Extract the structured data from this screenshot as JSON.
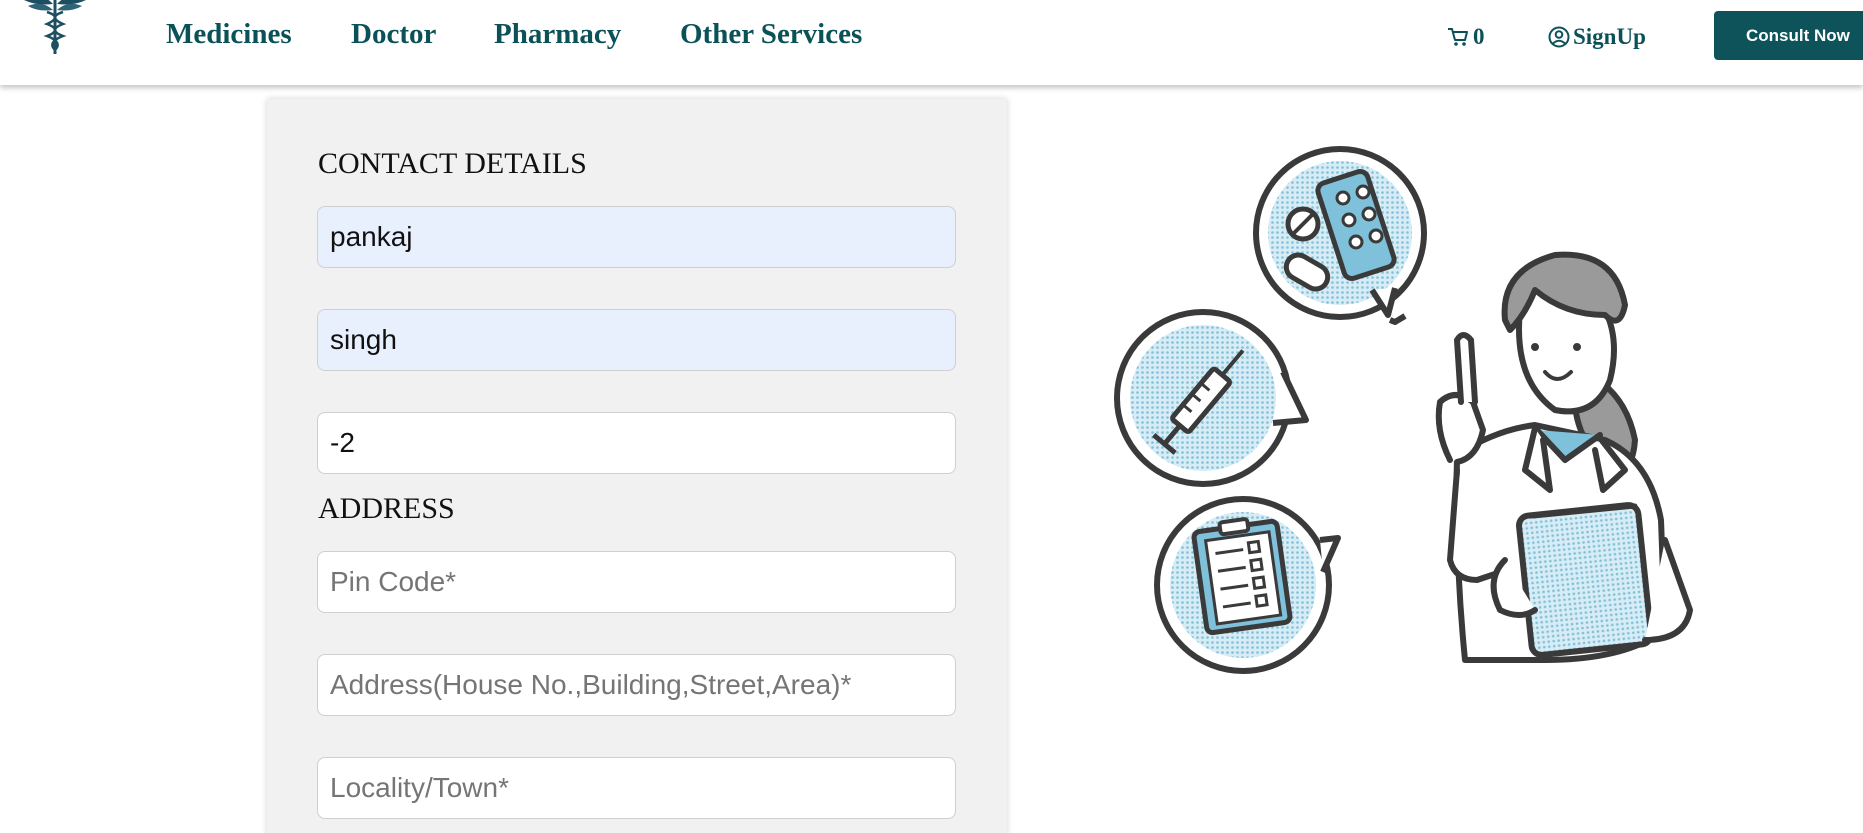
{
  "nav": {
    "links": [
      "Medicines",
      "Doctor",
      "Pharmacy",
      "Other Services"
    ],
    "cart_count": "0",
    "signup_label": "SignUp",
    "consult_label": "Consult Now"
  },
  "form": {
    "contact_title": "CONTACT DETAILS",
    "first_name_value": "pankaj",
    "last_name_value": "singh",
    "phone_value": "-2",
    "address_title": "ADDRESS",
    "pincode_placeholder": "Pin Code*",
    "address_placeholder": "Address(House No.,Building,Street,Area)*",
    "locality_placeholder": "Locality/Town*"
  },
  "colors": {
    "brand": "#0b5258",
    "button_bg": "#0e535a",
    "illustration_accent": "#7fc1db",
    "line": "#3a3a3a"
  }
}
